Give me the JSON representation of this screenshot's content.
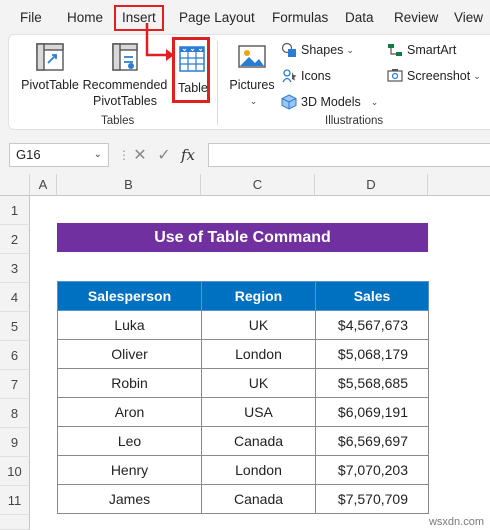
{
  "menu": {
    "tabs": [
      "File",
      "Home",
      "Insert",
      "Page Layout",
      "Formulas",
      "Data",
      "Review",
      "View"
    ],
    "active": "Insert"
  },
  "ribbon": {
    "tables_group": {
      "label": "Tables",
      "pivottable": "PivotTable",
      "recommended_line1": "Recommended",
      "recommended_line2": "PivotTables",
      "table": "Table"
    },
    "illustrations_group": {
      "label": "Illustrations",
      "pictures": "Pictures",
      "shapes": "Shapes",
      "icons": "Icons",
      "models3d": "3D Models",
      "smartart": "SmartArt",
      "screenshot": "Screenshot"
    }
  },
  "formula_bar": {
    "name_box": "G16",
    "cancel_symbol": "✕",
    "enter_symbol": "✓",
    "fx_symbol": "fx",
    "formula": ""
  },
  "grid": {
    "columns": [
      "A",
      "B",
      "C",
      "D"
    ],
    "rows": [
      "1",
      "2",
      "3",
      "4",
      "5",
      "6",
      "7",
      "8",
      "9",
      "10",
      "11"
    ],
    "title": "Use of Table Command",
    "headers": [
      "Salesperson",
      "Region",
      "Sales"
    ],
    "data": [
      [
        "Luka",
        "UK",
        "$4,567,673"
      ],
      [
        "Oliver",
        "London",
        "$5,068,179"
      ],
      [
        "Robin",
        "UK",
        "$5,568,685"
      ],
      [
        "Aron",
        "USA",
        "$6,069,191"
      ],
      [
        "Leo",
        "Canada",
        "$6,569,697"
      ],
      [
        "Henry",
        "London",
        "$7,070,203"
      ],
      [
        "James",
        "Canada",
        "$7,570,709"
      ]
    ]
  },
  "watermark": "wsxdn.com",
  "colors": {
    "title_fill": "#7030a0",
    "header_fill": "#0070c0",
    "highlight_red": "#e02020",
    "excel_green": "#107c41"
  }
}
